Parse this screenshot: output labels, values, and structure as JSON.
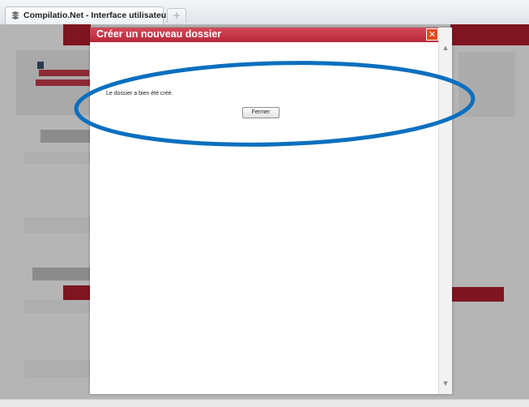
{
  "browser": {
    "tab_title": "Compilatio.Net - Interface utilisateur",
    "new_tab_label": "+",
    "favicon": "compilatio-favicon"
  },
  "dialog": {
    "title": "Créer un nouveau dossier",
    "close_label": "✕",
    "message": "Le dossier a bien été créé.",
    "button_label": "Fermer",
    "scroll_up": "▲",
    "scroll_down": "▼"
  },
  "annotation": {
    "color": "#0b6fbf"
  },
  "colors": {
    "dialog_header": "#c23447",
    "close_button": "#e8471c",
    "overlay": "#b5b5b5"
  }
}
